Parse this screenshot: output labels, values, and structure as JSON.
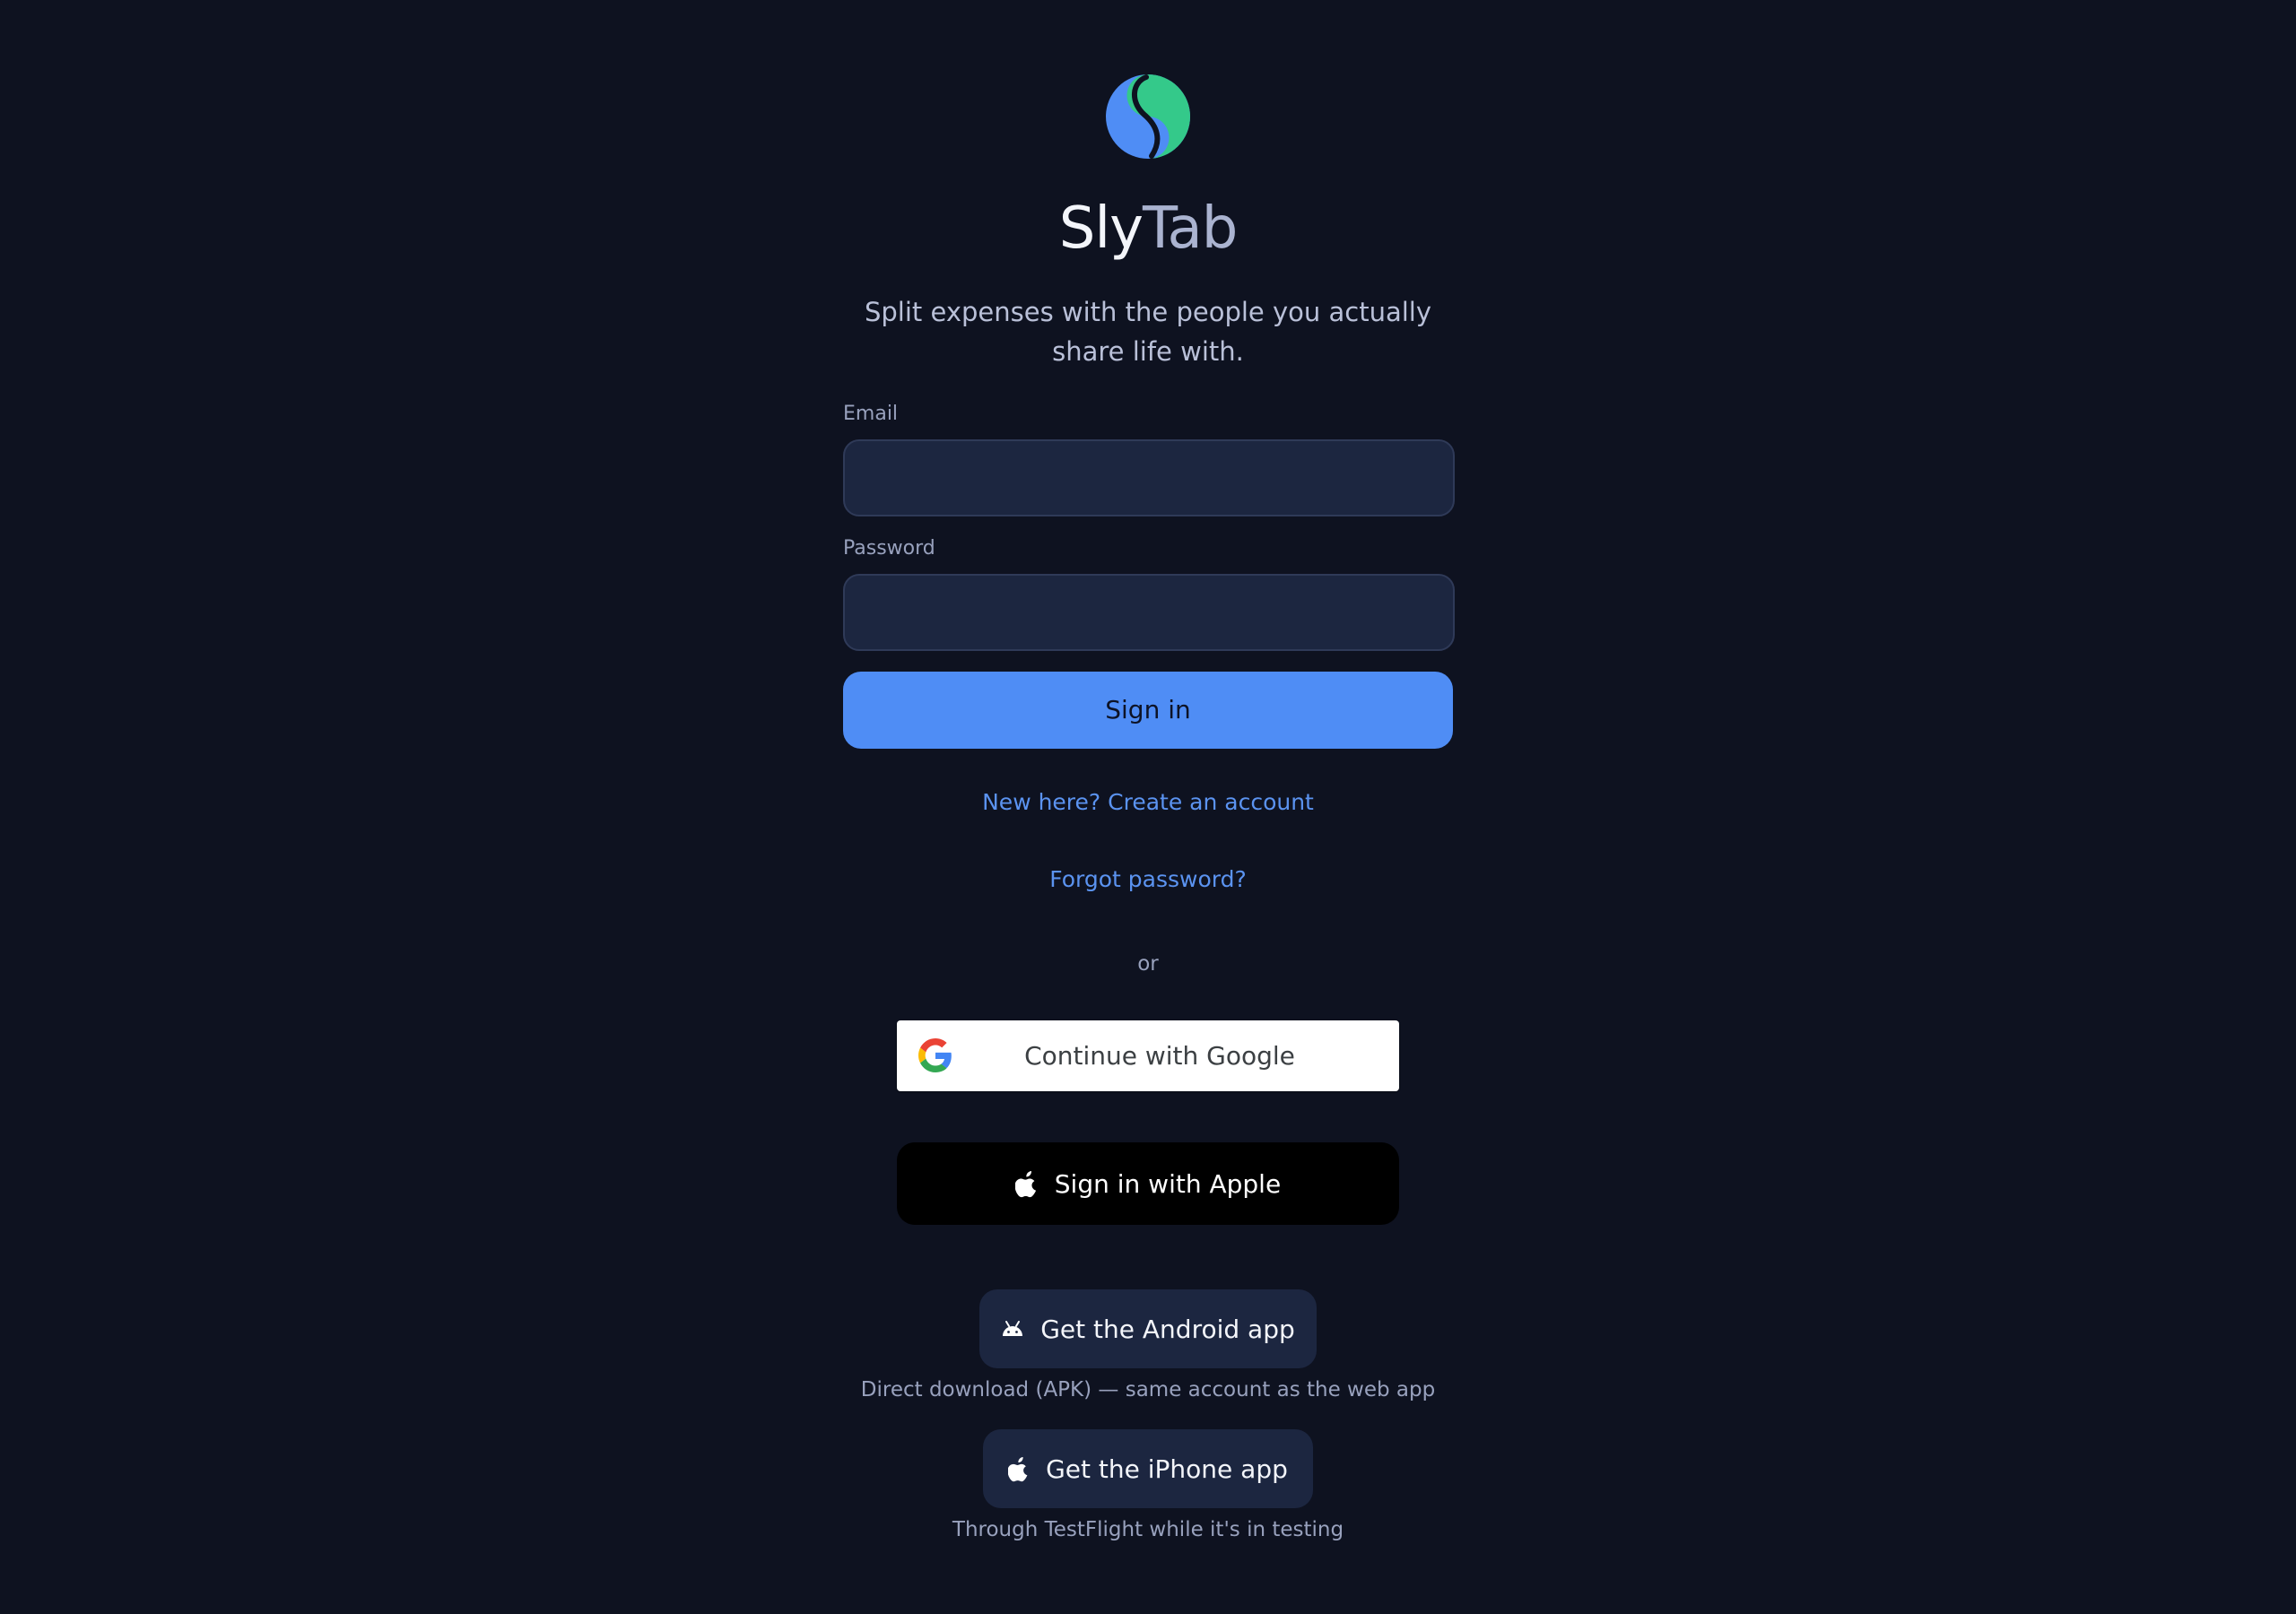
{
  "brand": {
    "logo_icon": "slytab-yin-yang-logo",
    "name_part_1": "Sly",
    "name_part_2": "Tab",
    "tagline": "Split expenses with the people you actually share life with."
  },
  "form": {
    "email_label": "Email",
    "email_value": "",
    "password_label": "Password",
    "password_value": "",
    "sign_in_label": "Sign in"
  },
  "links": {
    "create_account": "New here? Create an account",
    "forgot_password": "Forgot password?"
  },
  "divider_text": "or",
  "social": {
    "google_label": "Continue with Google",
    "google_icon": "google-g-icon",
    "apple_label": "Sign in with Apple",
    "apple_icon": "apple-icon"
  },
  "apps": {
    "android_label": "Get the Android app",
    "android_icon": "android-icon",
    "android_note": "Direct download (APK) — same account as the web app",
    "iphone_label": "Get the iPhone app",
    "iphone_icon": "apple-icon",
    "iphone_note": "Through TestFlight while it's in testing"
  },
  "colors": {
    "background": "#0e1220",
    "accent": "#4f8df5",
    "logo_blue": "#4f8df5",
    "logo_green": "#34c98a",
    "input_bg": "#1c2640"
  }
}
